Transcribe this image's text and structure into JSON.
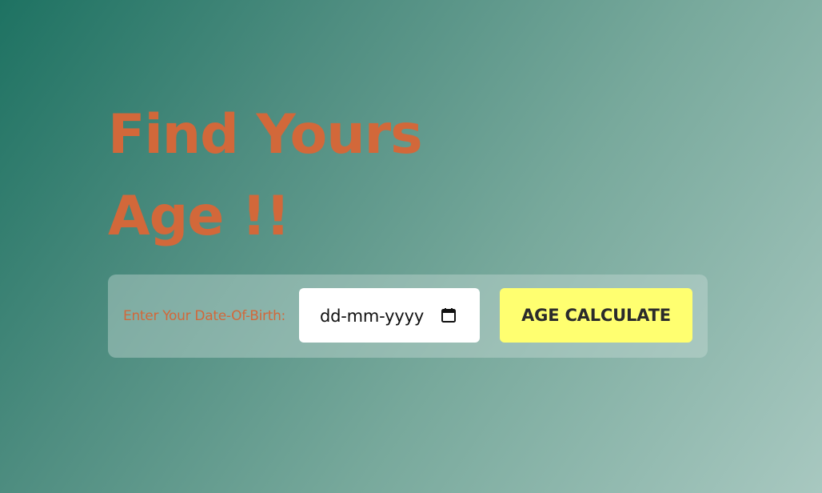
{
  "header": {
    "title_line1": "Find Yours",
    "title_line2": "Age !!"
  },
  "form": {
    "dob_label": "Enter Your Date-Of-Birth:",
    "date_placeholder": "dd-mm-yyyy",
    "date_icon": "calendar-icon",
    "submit_label": "AGE CALCULATE"
  },
  "colors": {
    "accent": "#d2683a",
    "button_bg": "#ffff70",
    "background_start": "#1e7262",
    "background_end": "#a8c8c0"
  }
}
